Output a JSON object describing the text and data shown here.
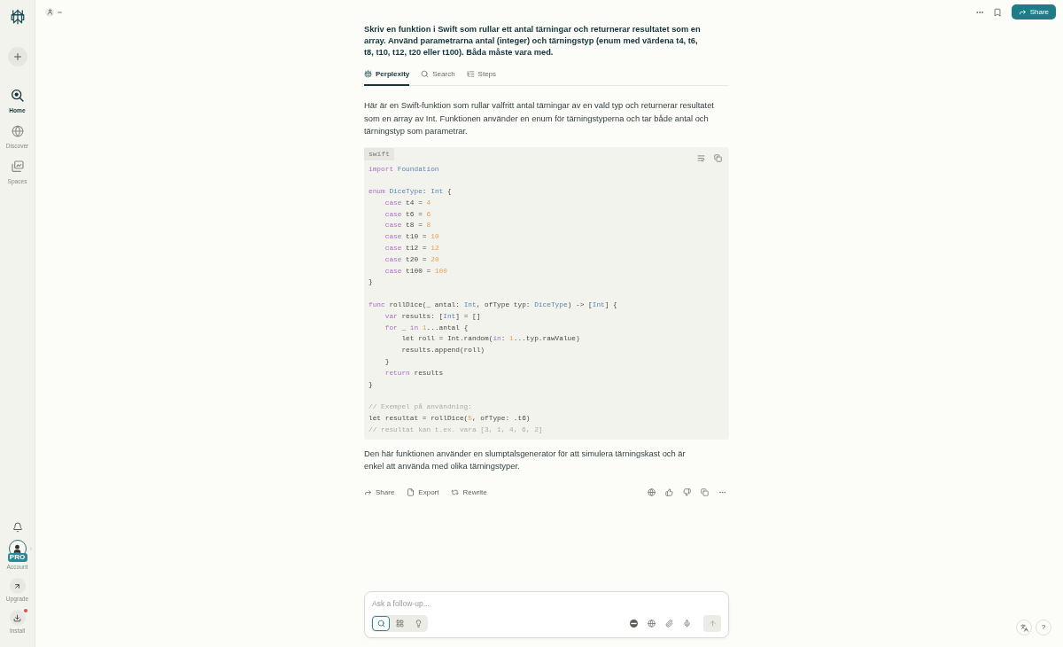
{
  "sidebar": {
    "items": [
      {
        "label": "Home",
        "selected": true
      },
      {
        "label": "Discover",
        "selected": false
      },
      {
        "label": "Spaces",
        "selected": false
      }
    ],
    "account": {
      "label": "Account",
      "badge": "PRO"
    },
    "upgrade": {
      "label": "Upgrade"
    },
    "install": {
      "label": "Install",
      "notification": true
    }
  },
  "header": {
    "share_button": "Share"
  },
  "thread": {
    "question": "Skriv en funktion i Swift som rullar ett antal tärningar och returnerar resultatet som en array. Använd parametrarna antal (integer) och tärningstyp (enum med värdena t4, t6, t8, t10, t12, t20 eller t100). Båda måste vara med.",
    "tabs": [
      {
        "label": "Perplexity",
        "selected": true
      },
      {
        "label": "Search",
        "selected": false
      },
      {
        "label": "Steps",
        "selected": false
      }
    ],
    "answer_intro": "Här är en Swift-funktion som rullar valfritt antal tärningar av en vald typ och returnerar resultatet som en array av Int. Funktionen använder en enum för tärningstyperna och tar både antal och tärningstyp som parametrar.",
    "code": {
      "language": "swift",
      "blocks": [
        [
          [
            {
              "text": "import",
              "kind": "keyword"
            },
            {
              "text": " Foundation",
              "kind": "type"
            }
          ]
        ],
        [
          [
            {
              "text": "enum",
              "kind": "keyword"
            },
            {
              "text": " DiceType",
              "kind": "type"
            },
            {
              "text": ": ",
              "kind": "plain"
            },
            {
              "text": "Int",
              "kind": "type"
            },
            {
              "text": " {",
              "kind": "plain"
            }
          ],
          [
            {
              "text": "    case",
              "kind": "keyword"
            },
            {
              "text": " t4 = ",
              "kind": "plain"
            },
            {
              "text": "4",
              "kind": "number"
            }
          ],
          [
            {
              "text": "    case",
              "kind": "keyword"
            },
            {
              "text": " t6 = ",
              "kind": "plain"
            },
            {
              "text": "6",
              "kind": "number"
            }
          ],
          [
            {
              "text": "    case",
              "kind": "keyword"
            },
            {
              "text": " t8 = ",
              "kind": "plain"
            },
            {
              "text": "8",
              "kind": "number"
            }
          ],
          [
            {
              "text": "    case",
              "kind": "keyword"
            },
            {
              "text": " t10 = ",
              "kind": "plain"
            },
            {
              "text": "10",
              "kind": "number"
            }
          ],
          [
            {
              "text": "    case",
              "kind": "keyword"
            },
            {
              "text": " t12 = ",
              "kind": "plain"
            },
            {
              "text": "12",
              "kind": "number"
            }
          ],
          [
            {
              "text": "    case",
              "kind": "keyword"
            },
            {
              "text": " t20 = ",
              "kind": "plain"
            },
            {
              "text": "20",
              "kind": "number"
            }
          ],
          [
            {
              "text": "    case",
              "kind": "keyword"
            },
            {
              "text": " t100 = ",
              "kind": "plain"
            },
            {
              "text": "100",
              "kind": "number"
            }
          ],
          [
            {
              "text": "}",
              "kind": "plain"
            }
          ]
        ],
        [
          [
            {
              "text": "func",
              "kind": "keyword"
            },
            {
              "text": " rollDice(_ antal: ",
              "kind": "plain"
            },
            {
              "text": "Int",
              "kind": "type"
            },
            {
              "text": ", ofType typ: ",
              "kind": "plain"
            },
            {
              "text": "DiceType",
              "kind": "type"
            },
            {
              "text": ") -> [",
              "kind": "plain"
            },
            {
              "text": "Int",
              "kind": "type"
            },
            {
              "text": "] {",
              "kind": "plain"
            }
          ],
          [
            {
              "text": "    var",
              "kind": "keyword"
            },
            {
              "text": " results: [",
              "kind": "plain"
            },
            {
              "text": "Int",
              "kind": "type"
            },
            {
              "text": "] = []",
              "kind": "plain"
            }
          ],
          [
            {
              "text": "    for",
              "kind": "keyword"
            },
            {
              "text": " _ ",
              "kind": "plain"
            },
            {
              "text": "in",
              "kind": "keyword"
            },
            {
              "text": " 1",
              "kind": "number"
            },
            {
              "text": "...antal {",
              "kind": "plain"
            }
          ],
          [
            {
              "text": "        let roll = Int.random(",
              "kind": "plain"
            },
            {
              "text": "in",
              "kind": "keyword"
            },
            {
              "text": ": ",
              "kind": "plain"
            },
            {
              "text": "1",
              "kind": "number"
            },
            {
              "text": "...typ.rawValue)",
              "kind": "plain"
            }
          ],
          [
            {
              "text": "        results.append(roll)",
              "kind": "plain"
            }
          ],
          [
            {
              "text": "    }",
              "kind": "plain"
            }
          ],
          [
            {
              "text": "    return",
              "kind": "keyword"
            },
            {
              "text": " results",
              "kind": "plain"
            }
          ],
          [
            {
              "text": "}",
              "kind": "plain"
            }
          ]
        ],
        [
          [
            {
              "text": "// Exempel på användning:",
              "kind": "comment"
            }
          ],
          [
            {
              "text": "let resultat = rollDice(",
              "kind": "plain"
            },
            {
              "text": "5",
              "kind": "number"
            },
            {
              "text": ", ofType: .t6)",
              "kind": "plain"
            }
          ],
          [
            {
              "text": "// resultat kan t.ex. vara [3, 1, 4, 6, 2]",
              "kind": "comment"
            }
          ]
        ]
      ]
    },
    "answer_outro": "Den här funktionen använder en slumptalsgenerator för att simulera tärningskast och är enkel att använda med olika tärningstyper.",
    "actions": [
      "Share",
      "Export",
      "Rewrite"
    ]
  },
  "composer": {
    "placeholder": "Ask a follow-up...",
    "modes": [
      {
        "selected": true
      },
      {
        "selected": false
      },
      {
        "selected": false
      }
    ]
  },
  "help_button": "?"
}
